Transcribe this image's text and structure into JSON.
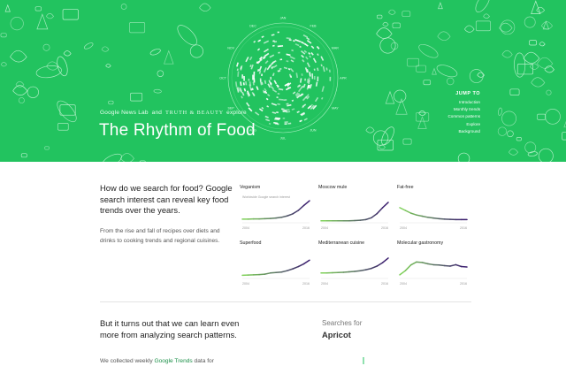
{
  "colors": {
    "hero_bg": "#22c35f",
    "doodle": "#c9f5d8",
    "link_green": "#1a8f47",
    "line_start": "#7fd05a",
    "line_end": "#3b1f6e"
  },
  "hero": {
    "title": "The Rhythm of Food",
    "credits": {
      "google_news_lab": "Google News Lab",
      "and": "and",
      "truth_beauty": "TRUTH & BEAUTY",
      "explore": "explore"
    },
    "radial_months": [
      "JAN",
      "FEB",
      "MAR",
      "APR",
      "MAY",
      "JUN",
      "JUL",
      "AUG",
      "SEP",
      "OCT",
      "NOV",
      "DEC"
    ],
    "jump_to": {
      "label": "JUMP TO",
      "links": [
        "Introduction",
        "Monthly trends",
        "Common patterns",
        "Explore",
        "Background"
      ]
    }
  },
  "intro": {
    "heading": "How do we search for food? Google search interest can reveal key food trends over the years.",
    "body": "From the rise and fall of recipes over diets and drinks to cooking trends and regional cuisines."
  },
  "trend_charts": [
    {
      "title": "Veganism",
      "subtitle": "Worldwide Google search interest",
      "x_start": "2004",
      "x_end": "2016",
      "values": [
        0.12,
        0.12,
        0.13,
        0.13,
        0.14,
        0.15,
        0.17,
        0.2,
        0.26,
        0.35,
        0.5,
        0.72,
        0.92
      ]
    },
    {
      "title": "Moscow mule",
      "subtitle": "",
      "x_start": "2004",
      "x_end": "2016",
      "values": [
        0.05,
        0.05,
        0.05,
        0.05,
        0.05,
        0.05,
        0.06,
        0.07,
        0.1,
        0.18,
        0.36,
        0.62,
        0.85
      ]
    },
    {
      "title": "Fat-free",
      "subtitle": "",
      "x_start": "2004",
      "x_end": "2016",
      "values": [
        0.62,
        0.5,
        0.38,
        0.3,
        0.25,
        0.2,
        0.17,
        0.14,
        0.12,
        0.11,
        0.1,
        0.1,
        0.1
      ]
    },
    {
      "title": "Superfood",
      "subtitle": "",
      "x_start": "2004",
      "x_end": "2016",
      "values": [
        0.1,
        0.11,
        0.12,
        0.13,
        0.15,
        0.2,
        0.22,
        0.24,
        0.3,
        0.38,
        0.48,
        0.6,
        0.76
      ]
    },
    {
      "title": "Mediterranean cuisine",
      "subtitle": "",
      "x_start": "2004",
      "x_end": "2016",
      "values": [
        0.2,
        0.2,
        0.21,
        0.22,
        0.23,
        0.25,
        0.27,
        0.3,
        0.34,
        0.4,
        0.5,
        0.65,
        0.85
      ]
    },
    {
      "title": "Molecular gastronomy",
      "subtitle": "",
      "x_start": "2004",
      "x_end": "2016",
      "values": [
        0.12,
        0.3,
        0.55,
        0.68,
        0.66,
        0.6,
        0.56,
        0.55,
        0.52,
        0.5,
        0.56,
        0.48,
        0.46
      ]
    }
  ],
  "lower": {
    "heading": "But it turns out that we can learn even more from analyzing search patterns.",
    "body_prefix": "We collected weekly ",
    "body_link": "Google Trends",
    "body_suffix": " data for",
    "searches_for_label": "Searches for",
    "searches_for_term": "Apricot"
  }
}
